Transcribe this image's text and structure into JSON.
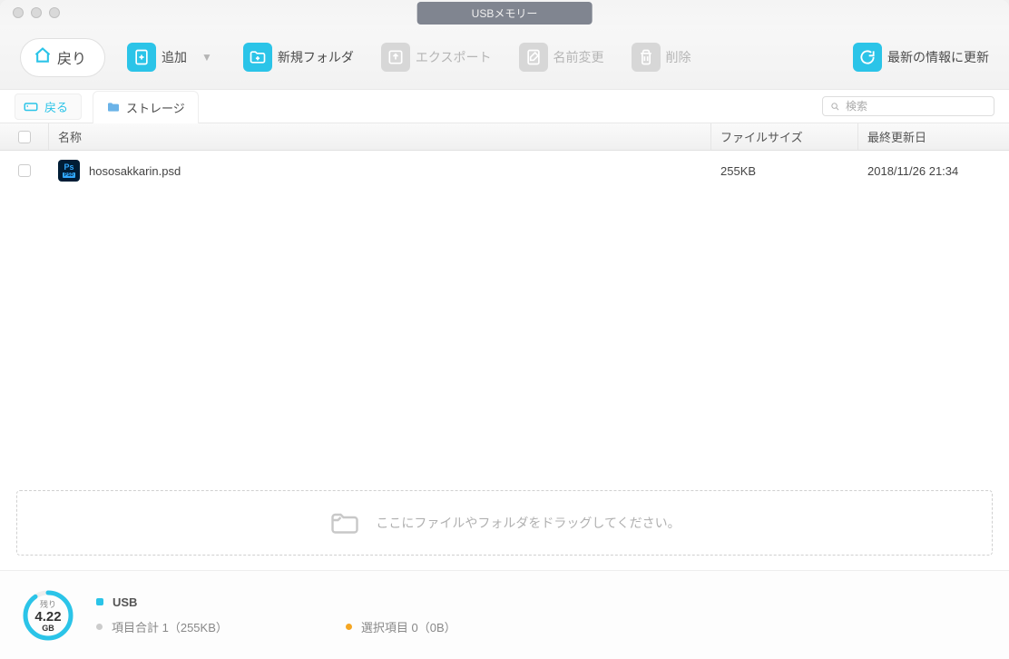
{
  "window": {
    "title": "USBメモリー"
  },
  "toolbar": {
    "back": "戻り",
    "add": "追加",
    "newfolder": "新規フォルダ",
    "export": "エクスポート",
    "rename": "名前変更",
    "delete": "削除",
    "refresh": "最新の情報に更新"
  },
  "breadcrumb": {
    "back": "戻る",
    "storage": "ストレージ",
    "search_placeholder": "検索"
  },
  "columns": {
    "name": "名称",
    "size": "ファイルサイズ",
    "date": "最終更新日"
  },
  "files": [
    {
      "name": "hososakkarin.psd",
      "size": "255KB",
      "date": "2018/11/26  21:34"
    }
  ],
  "dropzone": "ここにファイルやフォルダをドラッグしてください。",
  "footer": {
    "remaining_label": "残り",
    "remaining_value": "4.22",
    "remaining_unit": "GB",
    "usb_label": "USB",
    "total_label": "項目合計 1（255KB）",
    "selected_label": "選択項目 0（0B）"
  }
}
